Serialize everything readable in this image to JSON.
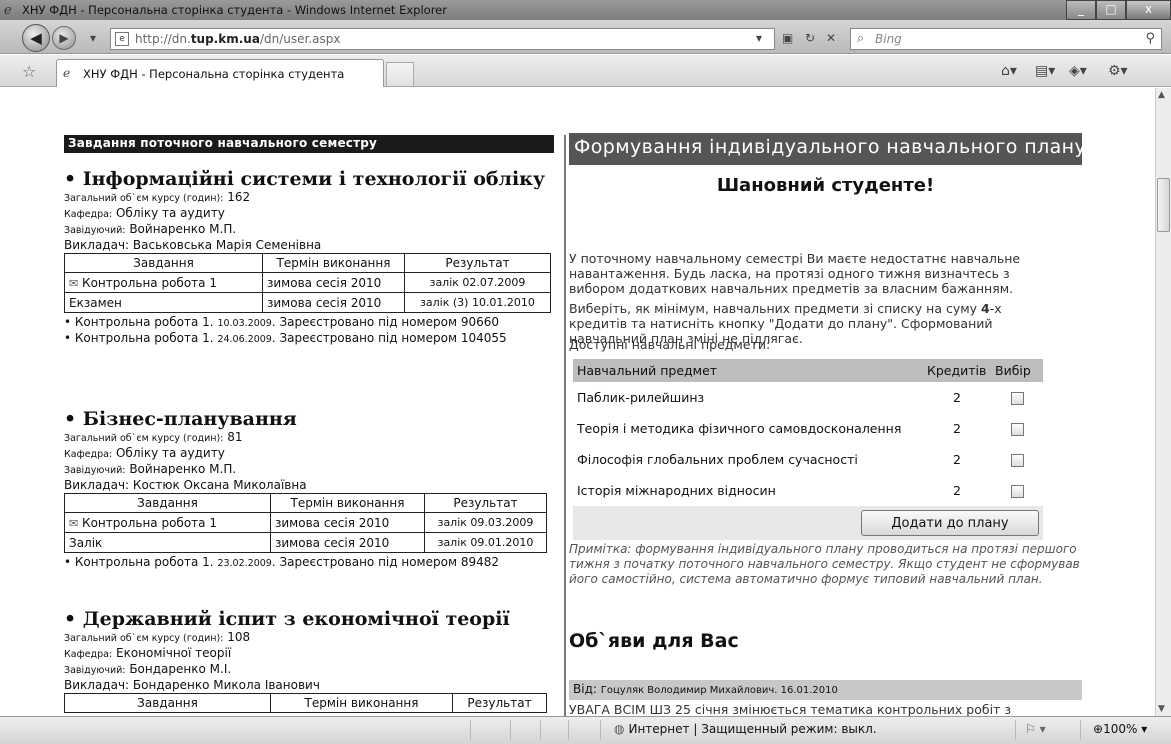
{
  "window": {
    "title": "ХНУ ФДН - Персональна сторінка студента - Windows Internet Explorer",
    "controls": [
      "_",
      "□",
      "x"
    ]
  },
  "navigation": {
    "back_icon": "back-arrow-icon",
    "forward_icon": "forward-arrow-icon",
    "url_prefix": "http://dn.",
    "url_host": "tup.km.ua",
    "url_suffix": "/dn/user.aspx",
    "search_placeholder": "Bing"
  },
  "tab": {
    "title": "ХНУ ФДН - Персональна сторінка студента"
  },
  "left": {
    "semester_header": "Завдання поточного навчального семестру",
    "courses": [
      {
        "title": "• Інформаційні системи і технології обліку",
        "volume_label": "Загальний об`єм курсу (годин):",
        "volume": "162",
        "dept_label": "Кафедра:",
        "dept": "Обліку та аудиту",
        "head_label": "Завідуючий:",
        "head": "Войнаренко М.П.",
        "teacher_label": "Викладач:",
        "teacher": "Васьковська Марія Семенівна",
        "table_headers": [
          "Завдання",
          "Термін виконання",
          "Результат"
        ],
        "rows": [
          {
            "task": "Контрольна робота 1",
            "term": "зимова сесія 2010",
            "result": "залік 02.07.2009"
          },
          {
            "task": "Екзамен",
            "term": "зимова сесія 2010",
            "result": "залік (3) 10.01.2010"
          }
        ],
        "notes": [
          {
            "prefix": "• Контрольна робота 1. ",
            "date": "10.03.2009",
            "text": ". Зареєстровано під номером 90660"
          },
          {
            "prefix": "• Контрольна робота 1. ",
            "date": "24.06.2009",
            "text": ". Зареєстровано під номером 104055"
          }
        ]
      },
      {
        "title": "• Бізнес-планування",
        "volume_label": "Загальний об`єм курсу (годин):",
        "volume": "81",
        "dept_label": "Кафедра:",
        "dept": "Обліку та аудиту",
        "head_label": "Завідуючий:",
        "head": "Войнаренко М.П.",
        "teacher_label": "Викладач:",
        "teacher": "Костюк Оксана Миколаївна",
        "table_headers": [
          "Завдання",
          "Термін виконання",
          "Результат"
        ],
        "rows": [
          {
            "task": "Контрольна робота 1",
            "term": "зимова сесія 2010",
            "result": "залік 09.03.2009"
          },
          {
            "task": "Залік",
            "term": "зимова сесія 2010",
            "result": "залік 09.01.2010"
          }
        ],
        "notes": [
          {
            "prefix": "• Контрольна робота 1. ",
            "date": "23.02.2009",
            "text": ". Зареєстровано під номером 89482"
          }
        ]
      },
      {
        "title": "• Державний іспит з економічної теорії",
        "volume_label": "Загальний об`єм курсу (годин):",
        "volume": "108",
        "dept_label": "Кафедра:",
        "dept": "Економічної теорії",
        "head_label": "Завідуючий:",
        "head": "Бондаренко М.І.",
        "teacher_label": "Викладач:",
        "teacher": "Бондаренко Микола Іванович",
        "table_headers": [
          "Завдання",
          "Термін виконання",
          "Результат"
        ]
      }
    ]
  },
  "right": {
    "header": "Формування індивідуального навчального плану",
    "greeting": "Шановний студенте!",
    "para1": "У поточному навчальному семестрі Ви маєте недостатнє навчальне навантаження. Будь ласка, на протязі одного тижня визначтесь з вибором додаткових навчальних предметів за власним бажанням.",
    "para2_a": "Виберіть, як мінімум, навчальних предмети зі списку на суму ",
    "para2_num": "4",
    "para2_b": "-х кредитів та натисніть кнопку \"Додати до плану\". Сформований навчальний план зміні не підлягає.",
    "available": "Доступні навчальні предмети:",
    "subj_headers": [
      "Навчальний предмет",
      "Кредитів",
      "Вибір"
    ],
    "subjects": [
      {
        "name": "Паблик-рилейшинз",
        "credits": "2"
      },
      {
        "name": "Теорія і методика фізичного самовдосконалення",
        "credits": "2"
      },
      {
        "name": "Філософія глобальних проблем сучасності",
        "credits": "2"
      },
      {
        "name": "Історія міжнародних відносин",
        "credits": "2"
      }
    ],
    "add_button": "Додати до плану",
    "remark": "Примітка: формування індивідуального плану проводиться на протязі першого тижня з початку поточного навчального семестру. Якщо студент не сформував його самостійно, система автоматично формує типовий навчальний план.",
    "ads_header": "Об`яви для Вас",
    "ad_from_label": "Від:",
    "ad_from": "Гоцуляк Володимир Михайлович. 16.01.2010",
    "ad_text": "УВАГА ВСІМ ШЗ 25 січня змінюється тематика контрольних робіт з"
  },
  "status": {
    "zone": "Интернет | Защищенный режим: выкл.",
    "zoom": "100%"
  }
}
